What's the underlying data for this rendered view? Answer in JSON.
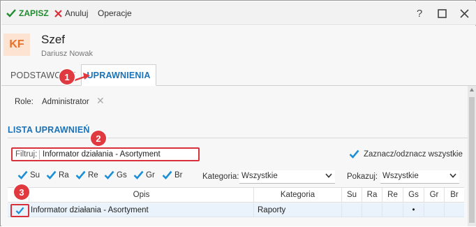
{
  "toolbar": {
    "save": "ZAPISZ",
    "cancel": "Anuluj",
    "operations": "Operacje",
    "help": "?",
    "colors": {
      "save": "#1f8b2e",
      "cancel": "#d9313a"
    }
  },
  "header": {
    "initials": "KF",
    "title": "Szef",
    "subtitle": "Dariusz Nowak"
  },
  "tabs": [
    {
      "label": "PODSTAWOWE",
      "active": false
    },
    {
      "label": "UPRAWNIENIA",
      "active": true
    }
  ],
  "role": {
    "label": "Role:",
    "value": "Administrator"
  },
  "section": {
    "title": "LISTA UPRAWNIEŃ"
  },
  "filter": {
    "label": "Filtruj:",
    "value": "Informator działania - Asortyment"
  },
  "toggle_all": {
    "label": "Zaznacz/odznacz wszystkie",
    "checked": true
  },
  "checks": [
    {
      "label": "Su",
      "checked": true
    },
    {
      "label": "Ra",
      "checked": true
    },
    {
      "label": "Re",
      "checked": true
    },
    {
      "label": "Gs",
      "checked": true
    },
    {
      "label": "Gr",
      "checked": true
    },
    {
      "label": "Br",
      "checked": true
    }
  ],
  "category": {
    "label": "Kategoria:",
    "value": "Wszystkie"
  },
  "show": {
    "label": "Pokazuj:",
    "value": "Wszystkie"
  },
  "table": {
    "headers": [
      "Opis",
      "Kategoria",
      "Su",
      "Ra",
      "Re",
      "Gs",
      "Gr",
      "Br"
    ],
    "rows": [
      {
        "checked": true,
        "opis": "Informator działania - Asortyment",
        "kategoria": "Raporty",
        "su": "",
        "ra": "",
        "re": "",
        "gs": "•",
        "gr": "",
        "br": ""
      }
    ]
  },
  "annotations": [
    "1",
    "2",
    "3"
  ],
  "accent": "#1a73b8",
  "badge_color": "#e0393f"
}
